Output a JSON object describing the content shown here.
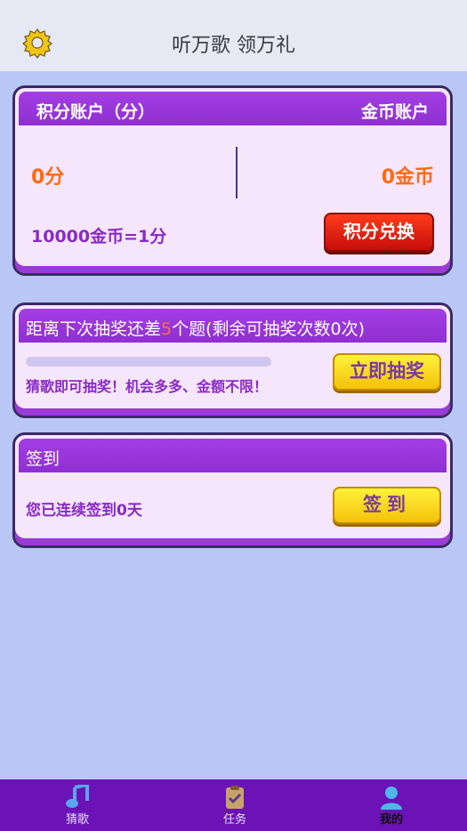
{
  "header": {
    "title": "听万歌 领万礼",
    "settings_icon": "gear-icon"
  },
  "points_card": {
    "left_title": "积分账户（分）",
    "right_title": "金币账户",
    "points_value": "0分",
    "coins_value": "0金币",
    "rate_text": "10000金币=1分",
    "exchange_button": "积分兑换"
  },
  "lottery_card": {
    "head_prefix": "距离下次抽奖还差",
    "head_count": "5",
    "head_suffix": "个题(剩余可抽奖次数0次)",
    "progress": 0,
    "tip": "猜歌即可抽奖！机会多多、金额不限！",
    "button": "立即抽奖"
  },
  "signin_card": {
    "title": "签到",
    "tip": "您已连续签到0天",
    "button": "签到"
  },
  "bottom_nav": {
    "items": [
      {
        "label": "猜歌",
        "icon": "music-note-icon"
      },
      {
        "label": "任务",
        "icon": "clipboard-check-icon"
      },
      {
        "label": "我的",
        "icon": "user-icon",
        "active": true
      }
    ]
  },
  "colors": {
    "accent": "#9a3bd8",
    "value": "#ff6a12",
    "nav_bg": "#6b13b6"
  }
}
